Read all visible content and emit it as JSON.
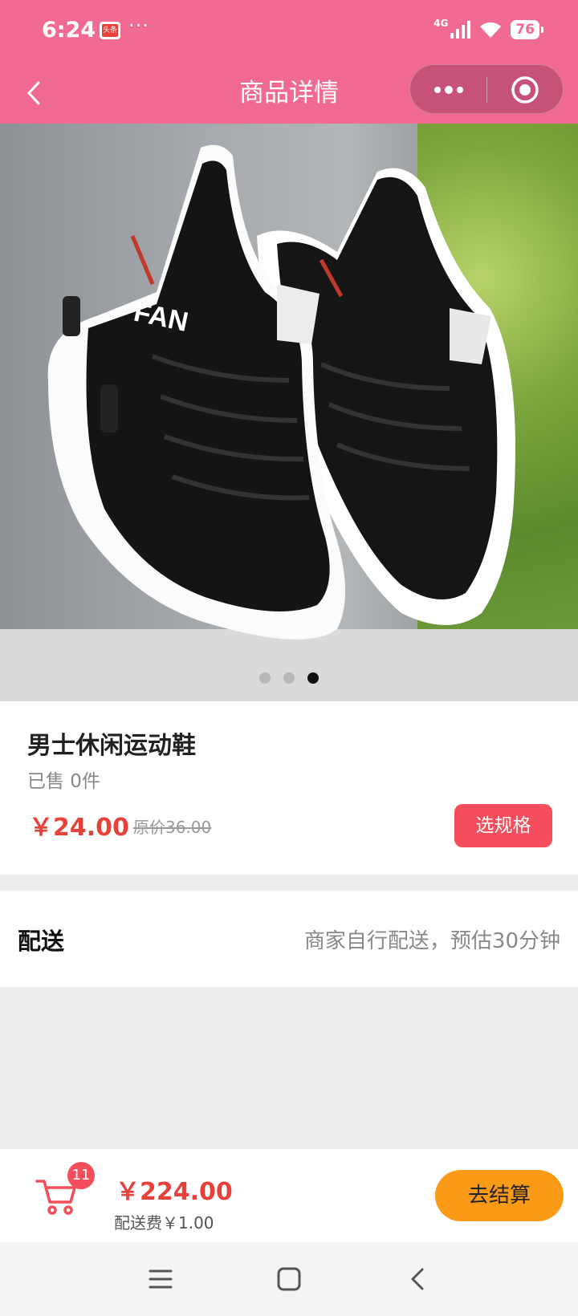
{
  "status_bar": {
    "time": "6:24",
    "app_badge": "头条",
    "more": "···",
    "network": "4G",
    "battery": "76",
    "icons": [
      "signal-icon",
      "wifi-icon",
      "battery-icon"
    ]
  },
  "nav": {
    "title": "商品详情",
    "back_icon": "chevron-left-icon",
    "more_icon": "more-dots-icon",
    "close_icon": "target-circle-icon"
  },
  "gallery": {
    "image_alt": "black sneakers",
    "page_count": 3,
    "active_page": 3
  },
  "product": {
    "name": "男士休闲运动鞋",
    "sold": "已售 0件",
    "price": "￥24.00",
    "original_price": "原价36.00",
    "spec_button": "选规格"
  },
  "delivery": {
    "label": "配送",
    "value": "商家自行配送，预估30分钟"
  },
  "bottom_bar": {
    "cart_count": "11",
    "total": "￥224.00",
    "shipping_fee": "配送费￥1.00",
    "checkout": "去结算"
  },
  "system_nav": {
    "icons": [
      "menu-icon",
      "home-square-icon",
      "back-icon"
    ]
  },
  "colors": {
    "header": "#f06a92",
    "price_red": "#e8413a",
    "button_red": "#f44d5b",
    "checkout_orange": "#fb9a16"
  }
}
